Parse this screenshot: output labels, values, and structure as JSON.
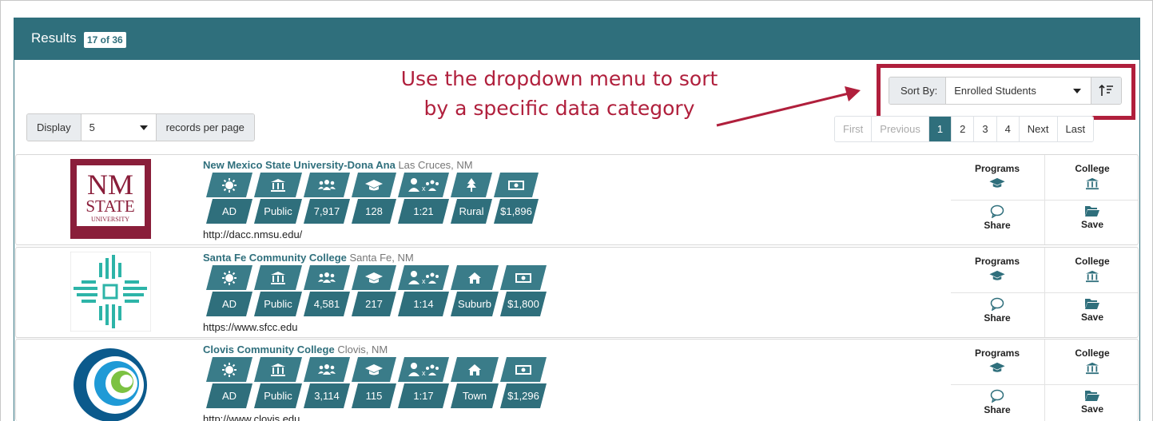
{
  "header": {
    "title": "Results",
    "count": "17 of 36"
  },
  "display": {
    "label": "Display",
    "value": "5",
    "suffix": "records per page"
  },
  "annotation": {
    "line1": "Use the dropdown menu to sort",
    "line2": "by a specific data category"
  },
  "sort": {
    "label": "Sort By:",
    "value": "Enrolled Students",
    "order_icon": "sort-descending-icon"
  },
  "pagination": [
    "First",
    "Previous",
    "1",
    "2",
    "3",
    "4",
    "Next",
    "Last"
  ],
  "pagination_active": "1",
  "columns_icons": [
    "sun-icon",
    "institution-icon",
    "users-icon",
    "graduation-cap-icon",
    "student-faculty-ratio-icon",
    "setting-icon",
    "money-icon"
  ],
  "actions": {
    "programs": "Programs",
    "college": "College",
    "share": "Share",
    "save": "Save"
  },
  "colors": {
    "primary": "#2f6f7c",
    "chip": "#3a7c89",
    "annotation": "#b01f3c"
  },
  "results": [
    {
      "name": "New Mexico State University-Dona Ana",
      "location": "Las Cruces, NM",
      "values": [
        "AD",
        "Public",
        "7,917",
        "128",
        "1:21",
        "Rural",
        "$1,896"
      ],
      "setting_icon": "tree-icon",
      "url": "http://dacc.nmsu.edu/",
      "logo": {
        "line1": "NM",
        "line2": "STATE",
        "line3": "UNIVERSITY"
      }
    },
    {
      "name": "Santa Fe Community College",
      "location": "Santa Fe, NM",
      "values": [
        "AD",
        "Public",
        "4,581",
        "217",
        "1:14",
        "Suburb",
        "$1,800"
      ],
      "setting_icon": "house-icon",
      "url": "https://www.sfcc.edu"
    },
    {
      "name": "Clovis Community College",
      "location": "Clovis, NM",
      "values": [
        "AD",
        "Public",
        "3,114",
        "115",
        "1:17",
        "Town",
        "$1,296"
      ],
      "setting_icon": "house-icon",
      "url": "http://www.clovis.edu"
    }
  ]
}
